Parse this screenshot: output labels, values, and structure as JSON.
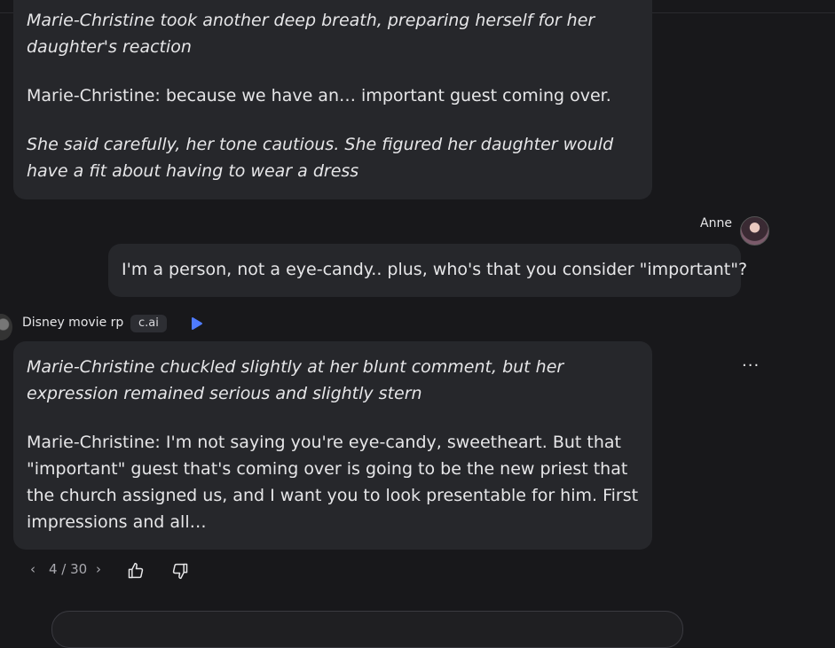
{
  "messages": [
    {
      "paragraphs": [
        {
          "text": "Marie-Christine took another deep breath, preparing herself for her daughter's reaction",
          "italic": true
        },
        {
          "text": "Marie-Christine: because we have an… important guest coming over.",
          "italic": false
        },
        {
          "text": "She said carefully, her tone cautious. She figured her daughter would have a fit about having to wear a dress",
          "italic": true
        }
      ]
    },
    {
      "user_name": "Anne",
      "text": "I'm a person, not a eye-candy.. plus, who's that you consider \"important\"?"
    },
    {
      "bot_name": "Disney movie rp",
      "tag": "c.ai",
      "paragraphs": [
        {
          "text": "Marie-Christine chuckled slightly at her blunt comment, but her expression remained serious and slightly stern",
          "italic": true
        },
        {
          "text": "Marie-Christine: I'm not saying you're eye-candy, sweetheart. But that \"important\" guest that's coming over is going to be the new priest that the church assigned us, and I want you to look presentable for him. First impressions and all…",
          "italic": false
        }
      ]
    }
  ],
  "controls": {
    "pager": "4 / 30",
    "prev_icon": "chevron-left-icon",
    "next_icon": "chevron-right-icon",
    "like_icon": "thumbs-up-icon",
    "dislike_icon": "thumbs-down-icon",
    "more_icon": "ellipsis-icon",
    "more_glyph": "···",
    "play_icon": "play-icon",
    "prev_glyph": "‹",
    "next_glyph": "›"
  },
  "colors": {
    "background": "#18181b",
    "bubble": "#26272b",
    "accent": "#4f7bff"
  }
}
